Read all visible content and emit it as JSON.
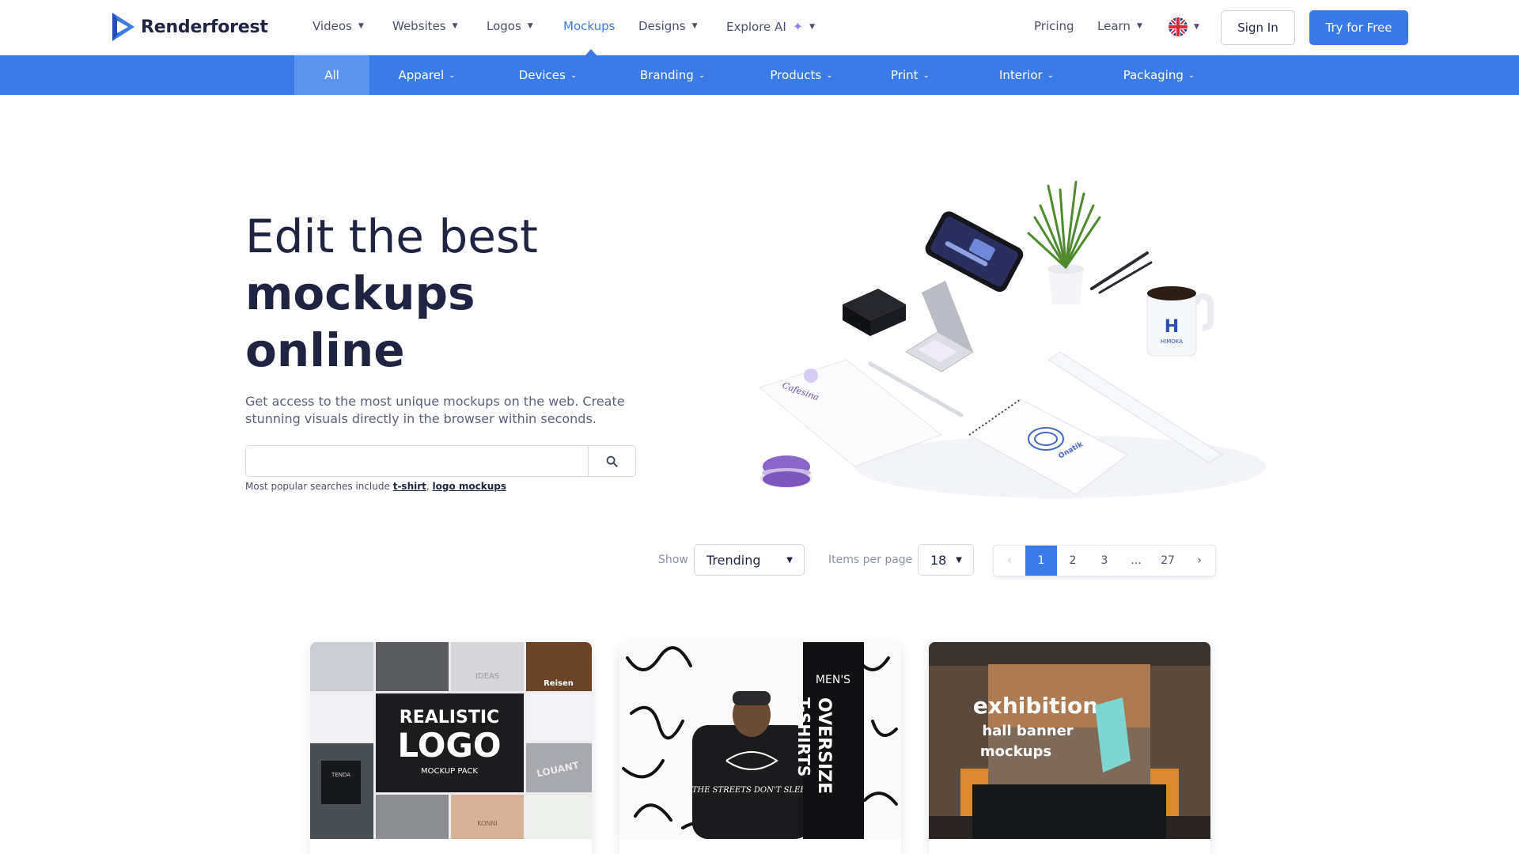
{
  "brand": {
    "name": "Renderforest",
    "accent": "#3b7be8"
  },
  "nav": {
    "items": [
      {
        "label": "Videos",
        "caret": true
      },
      {
        "label": "Websites",
        "caret": true
      },
      {
        "label": "Logos",
        "caret": true
      },
      {
        "label": "Mockups",
        "caret": false,
        "active": true
      },
      {
        "label": "Designs",
        "caret": true
      },
      {
        "label": "Explore AI",
        "caret": true
      }
    ],
    "pricing": "Pricing",
    "learn": "Learn",
    "language_icon": "uk-flag-icon",
    "sign_in": "Sign In",
    "try_free": "Try for Free"
  },
  "categories": [
    {
      "label": "All",
      "active": true
    },
    {
      "label": "Apparel"
    },
    {
      "label": "Devices"
    },
    {
      "label": "Branding"
    },
    {
      "label": "Products"
    },
    {
      "label": "Print"
    },
    {
      "label": "Interior"
    },
    {
      "label": "Packaging"
    }
  ],
  "hero": {
    "title_line1": "Edit the best",
    "title_line2": "mockups",
    "title_line3": "online",
    "description": "Get access to the most unique mockups on the web. Create stunning visuals directly in the browser within seconds.",
    "search_placeholder": "",
    "popular_prefix": "Most popular searches include",
    "popular_links": [
      "t-shirt",
      "logo mockups"
    ],
    "art_texts": {
      "mug_brand": "HIMOKA",
      "notebook_brand": "Onatik",
      "card_script": "Cafesina"
    }
  },
  "controls": {
    "show_label": "Show",
    "show_value": "Trending",
    "per_page_label": "Items per page",
    "per_page_value": "18",
    "pages": [
      "1",
      "2",
      "3",
      "...",
      "27"
    ],
    "current_page": "1"
  },
  "cards": [
    {
      "title_l1": "REALISTIC",
      "title_l2": "LOGO",
      "title_l3": "MOCKUP PACK",
      "tiles": [
        "Reisen",
        "LOUANT",
        "IDEAS",
        "KONNI",
        "TENDA"
      ]
    },
    {
      "side_l1": "MEN'S",
      "side_l2": "OVERSIZE",
      "side_l3": "T-SHIRTS",
      "shirt_text": "THE STREETS DON'T SLEEP"
    },
    {
      "title_l1": "exhibition",
      "title_l2": "hall banner",
      "title_l3": "mockups"
    }
  ]
}
